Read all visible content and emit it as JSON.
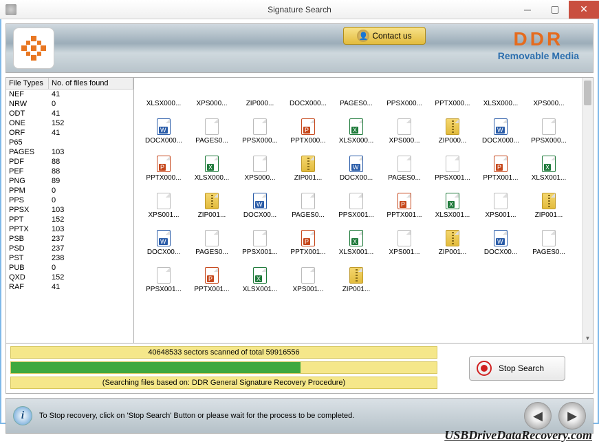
{
  "titlebar": {
    "title": "Signature Search"
  },
  "banner": {
    "contact_label": "Contact us",
    "brand_main": "DDR",
    "brand_sub": "Removable Media"
  },
  "table": {
    "header_type": "File Types",
    "header_count": "No. of files found",
    "rows": [
      {
        "type": "NEF",
        "count": "41"
      },
      {
        "type": "NRW",
        "count": "0"
      },
      {
        "type": "ODT",
        "count": "41"
      },
      {
        "type": "ONE",
        "count": "152"
      },
      {
        "type": "ORF",
        "count": "41"
      },
      {
        "type": "P65",
        "count": ""
      },
      {
        "type": "PAGES",
        "count": "103"
      },
      {
        "type": "PDF",
        "count": "88"
      },
      {
        "type": "PEF",
        "count": "88"
      },
      {
        "type": "PNG",
        "count": "89"
      },
      {
        "type": "PPM",
        "count": "0"
      },
      {
        "type": "PPS",
        "count": "0"
      },
      {
        "type": "PPSX",
        "count": "103"
      },
      {
        "type": "PPT",
        "count": "152"
      },
      {
        "type": "PPTX",
        "count": "103"
      },
      {
        "type": "PSB",
        "count": "237"
      },
      {
        "type": "PSD",
        "count": "237"
      },
      {
        "type": "PST",
        "count": "238"
      },
      {
        "type": "PUB",
        "count": "0"
      },
      {
        "type": "QXD",
        "count": "152"
      },
      {
        "type": "RAF",
        "count": "41"
      }
    ]
  },
  "files": [
    {
      "name": "XLSX000...",
      "icon": "excel",
      "hideicon": true
    },
    {
      "name": "XPS000...",
      "icon": "blank",
      "hideicon": true
    },
    {
      "name": "ZIP000...",
      "icon": "zip",
      "hideicon": true
    },
    {
      "name": "DOCX000...",
      "icon": "word",
      "hideicon": true
    },
    {
      "name": "PAGES0...",
      "icon": "blank",
      "hideicon": true
    },
    {
      "name": "PPSX000...",
      "icon": "blank",
      "hideicon": true
    },
    {
      "name": "PPTX000...",
      "icon": "ppt",
      "hideicon": true
    },
    {
      "name": "XLSX000...",
      "icon": "excel",
      "hideicon": true
    },
    {
      "name": "XPS000...",
      "icon": "blank",
      "hideicon": true
    },
    {
      "name": "DOCX000...",
      "icon": "word"
    },
    {
      "name": "PAGES0...",
      "icon": "blank"
    },
    {
      "name": "PPSX000...",
      "icon": "blank"
    },
    {
      "name": "PPTX000...",
      "icon": "ppt"
    },
    {
      "name": "XLSX000...",
      "icon": "excel"
    },
    {
      "name": "XPS000...",
      "icon": "blank"
    },
    {
      "name": "ZIP000...",
      "icon": "zip"
    },
    {
      "name": "DOCX000...",
      "icon": "word"
    },
    {
      "name": "PPSX000...",
      "icon": "blank"
    },
    {
      "name": "PPTX000...",
      "icon": "ppt"
    },
    {
      "name": "XLSX000...",
      "icon": "excel"
    },
    {
      "name": "XPS000...",
      "icon": "blank"
    },
    {
      "name": "ZIP001...",
      "icon": "zip"
    },
    {
      "name": "DOCX00...",
      "icon": "word"
    },
    {
      "name": "PAGES0...",
      "icon": "blank"
    },
    {
      "name": "PPSX001...",
      "icon": "blank"
    },
    {
      "name": "PPTX001...",
      "icon": "ppt"
    },
    {
      "name": "XLSX001...",
      "icon": "excel"
    },
    {
      "name": "XPS001...",
      "icon": "blank"
    },
    {
      "name": "ZIP001...",
      "icon": "zip"
    },
    {
      "name": "DOCX00...",
      "icon": "word"
    },
    {
      "name": "PAGES0...",
      "icon": "blank"
    },
    {
      "name": "PPSX001...",
      "icon": "blank"
    },
    {
      "name": "PPTX001...",
      "icon": "ppt"
    },
    {
      "name": "XLSX001...",
      "icon": "excel"
    },
    {
      "name": "XPS001...",
      "icon": "blank"
    },
    {
      "name": "ZIP001...",
      "icon": "zip"
    },
    {
      "name": "DOCX00...",
      "icon": "word"
    },
    {
      "name": "PAGES0...",
      "icon": "blank"
    },
    {
      "name": "PPSX001...",
      "icon": "blank"
    },
    {
      "name": "PPTX001...",
      "icon": "ppt"
    },
    {
      "name": "XLSX001...",
      "icon": "excel"
    },
    {
      "name": "XPS001...",
      "icon": "blank"
    },
    {
      "name": "ZIP001...",
      "icon": "zip"
    },
    {
      "name": "DOCX00...",
      "icon": "word"
    },
    {
      "name": "PAGES0...",
      "icon": "blank"
    },
    {
      "name": "PPSX001...",
      "icon": "blank"
    },
    {
      "name": "PPTX001...",
      "icon": "ppt"
    },
    {
      "name": "XLSX001...",
      "icon": "excel"
    },
    {
      "name": "XPS001...",
      "icon": "blank"
    },
    {
      "name": "ZIP001...",
      "icon": "zip"
    }
  ],
  "status": {
    "scanned_text": "40648533 sectors scanned of total 59916556",
    "progress_pct": 68,
    "note": "(Searching files based on:  DDR General Signature Recovery Procedure)",
    "stop_label": "Stop Search"
  },
  "footer": {
    "info_text": "To Stop recovery, click on 'Stop Search' Button or please wait for the process to be completed."
  },
  "watermark": "USBDriveDataRecovery.com"
}
